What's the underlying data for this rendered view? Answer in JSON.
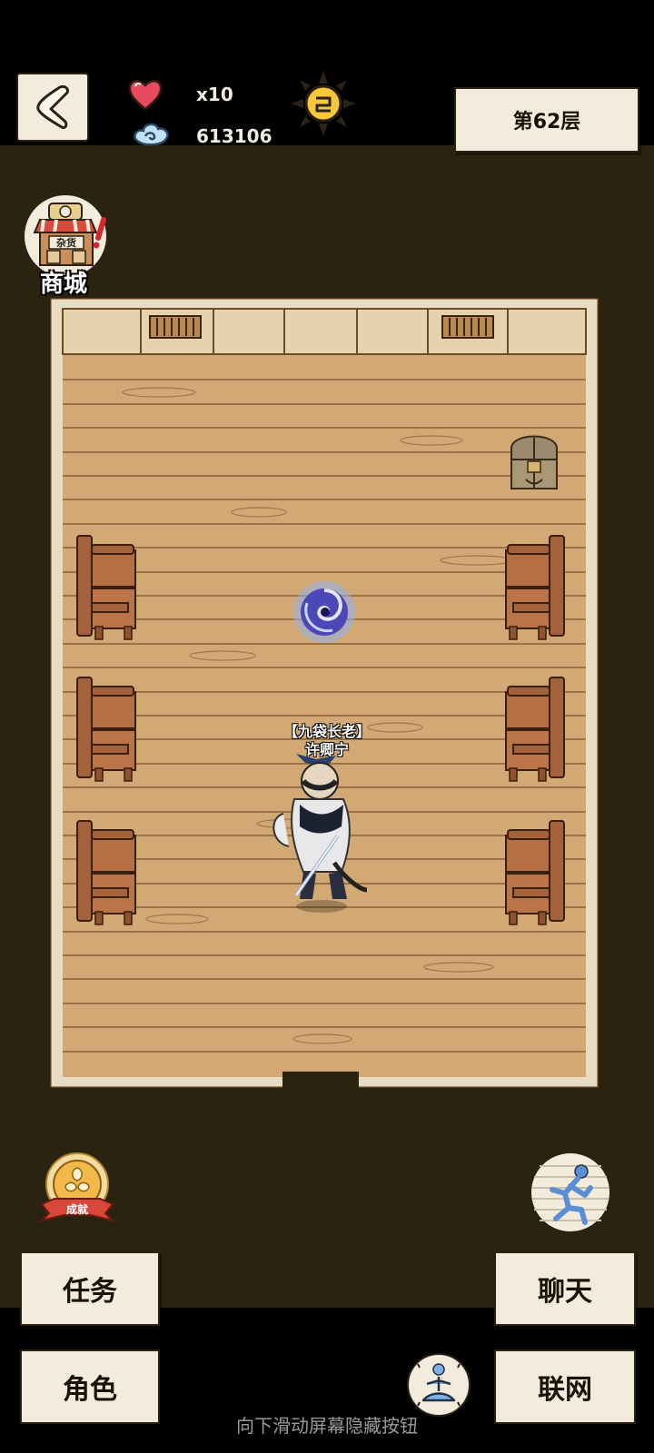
{
  "header": {
    "hearts_count": "x10",
    "currency_value": "613106",
    "floor_label": "第62层"
  },
  "shop": {
    "label": "商城",
    "sign_text": "杂货"
  },
  "achievement": {
    "ribbon_text": "成就"
  },
  "npc": {
    "title": "【九袋长老】",
    "name": "许卿宁"
  },
  "buttons": {
    "task": "任务",
    "chat": "聊天",
    "role": "角色",
    "network": "联网"
  },
  "hint": "向下滑动屏幕隐藏按钮",
  "colors": {
    "floor_wood": "#d2a874",
    "floor_line": "#8a5f34",
    "wall": "#e6d2ac",
    "chair": "#a4623a",
    "background": "#2a2310",
    "paper": "#f3ecdc"
  },
  "icons": {
    "back": "chevron-left-icon",
    "heart": "heart-icon",
    "currency": "cloud-swirl-icon",
    "sun": "sun-icon",
    "shop": "shop-icon",
    "achievement": "achievement-icon",
    "run": "running-man-icon",
    "meditate": "meditate-icon"
  }
}
